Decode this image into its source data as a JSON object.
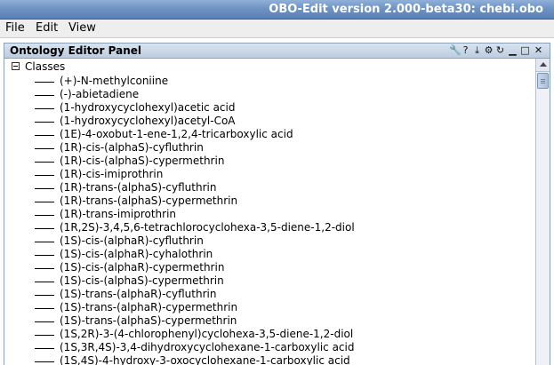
{
  "window": {
    "title": "OBO-Edit version 2.000-beta30: chebi.obo"
  },
  "menubar": {
    "items": [
      "File",
      "Edit",
      "View"
    ]
  },
  "panel": {
    "title": "Ontology Editor Panel",
    "buttons": [
      {
        "icon": "wrench-icon",
        "glyph": "🔧"
      },
      {
        "icon": "help-icon",
        "glyph": "?"
      },
      {
        "icon": "pin-icon",
        "glyph": "⤓"
      },
      {
        "icon": "gear-icon",
        "glyph": "⚙"
      },
      {
        "icon": "refresh-icon",
        "glyph": "↻"
      },
      {
        "icon": "minimize-icon",
        "glyph": "▁"
      },
      {
        "icon": "maximize-icon",
        "glyph": "□"
      },
      {
        "icon": "close-icon",
        "glyph": "✕"
      }
    ]
  },
  "tree": {
    "root_label": "Classes",
    "items": [
      "(+)-N-methylconiine",
      "(-)-abietadiene",
      "(1-hydroxycyclohexyl)acetic acid",
      "(1-hydroxycyclohexyl)acetyl-CoA",
      "(1E)-4-oxobut-1-ene-1,2,4-tricarboxylic acid",
      "(1R)-cis-(alphaS)-cyfluthrin",
      "(1R)-cis-(alphaS)-cypermethrin",
      "(1R)-cis-imiprothrin",
      "(1R)-trans-(alphaS)-cyfluthrin",
      "(1R)-trans-(alphaS)-cypermethrin",
      "(1R)-trans-imiprothrin",
      "(1R,2S)-3,4,5,6-tetrachlorocyclohexa-3,5-diene-1,2-diol",
      "(1S)-cis-(alphaR)-cyfluthrin",
      "(1S)-cis-(alphaR)-cyhalothrin",
      "(1S)-cis-(alphaR)-cypermethrin",
      "(1S)-cis-(alphaS)-cypermethrin",
      "(1S)-trans-(alphaR)-cyfluthrin",
      "(1S)-trans-(alphaR)-cypermethrin",
      "(1S)-trans-(alphaS)-cypermethrin",
      "(1S,2R)-3-(4-chlorophenyl)cyclohexa-3,5-diene-1,2-diol",
      "(1S,3R,4S)-3,4-dihydroxycyclohexane-1-carboxylic acid",
      "(1S,4S)-4-hydroxy-3-oxocyclohexane-1-carboxylic acid"
    ]
  },
  "colors": {
    "titlebar": "#6f93c4",
    "menubar": "#eeeeee",
    "panel_header": "#bccde0"
  }
}
